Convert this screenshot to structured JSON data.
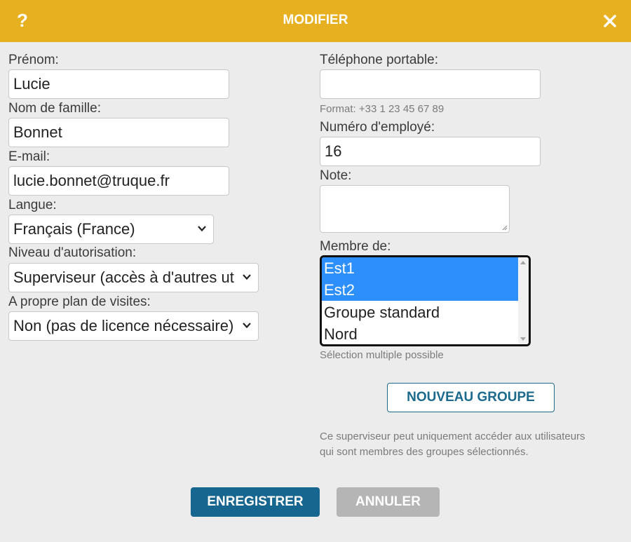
{
  "header": {
    "help_symbol": "?",
    "title": "MODIFIER",
    "background_color": "#e6b021"
  },
  "left": {
    "first_name": {
      "label": "Prénom:",
      "value": "Lucie"
    },
    "last_name": {
      "label": "Nom de famille:",
      "value": "Bonnet"
    },
    "email": {
      "label": "E-mail:",
      "value": "lucie.bonnet@truque.fr"
    },
    "language": {
      "label": "Langue:",
      "value": "Français (France)"
    },
    "authorization": {
      "label": "Niveau d'autorisation:",
      "value": "Superviseur (accès à d'autres ut"
    },
    "visit_plan": {
      "label": "A propre plan de visites:",
      "value": "Non (pas de licence nécessaire)"
    }
  },
  "right": {
    "mobile": {
      "label": "Téléphone portable:",
      "value": "",
      "hint": "Format: +33 1 23 45 67 89"
    },
    "employee_number": {
      "label": "Numéro d'employé:",
      "value": "16"
    },
    "note": {
      "label": "Note:",
      "value": ""
    },
    "member_of": {
      "label": "Membre de:",
      "options": [
        {
          "label": "Est1",
          "selected": true
        },
        {
          "label": "Est2",
          "selected": true
        },
        {
          "label": "Groupe standard",
          "selected": false
        },
        {
          "label": "Nord",
          "selected": false
        }
      ],
      "hint": "Sélection multiple possible",
      "selected_color": "#2d8ffb"
    },
    "new_group_label": "NOUVEAU GROUPE",
    "info_line1": "Ce superviseur peut uniquement accéder aux utilisateurs",
    "info_line2": "qui sont membres des groupes sélectionnés."
  },
  "footer": {
    "save_label": "ENREGISTRER",
    "cancel_label": "ANNULER",
    "save_color": "#16668f",
    "cancel_color": "#b5b5b5"
  }
}
